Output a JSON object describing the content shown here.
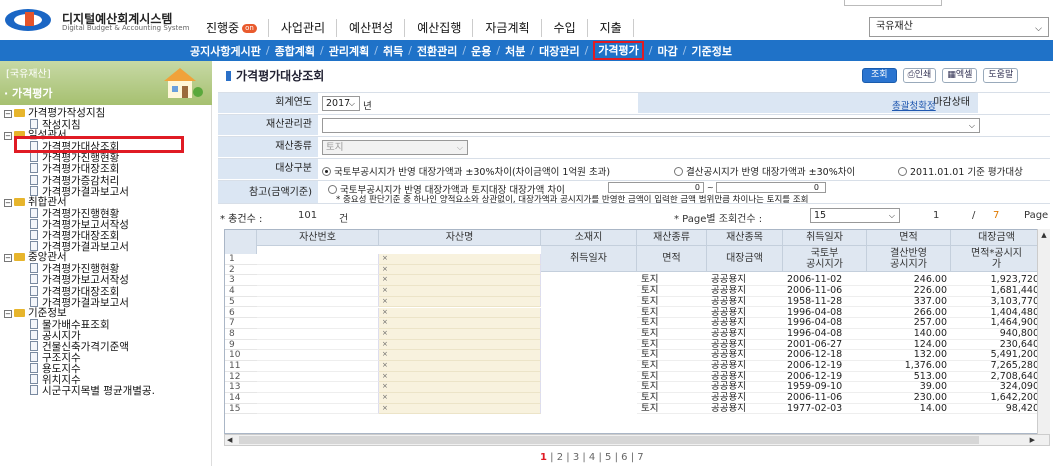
{
  "app": {
    "title": "디지털예산회계시스템",
    "subtitle": "Digital Budget & Accounting System"
  },
  "mainnav": [
    {
      "label": "진행중",
      "badge": "on"
    },
    {
      "label": "사업관리"
    },
    {
      "label": "예산편성"
    },
    {
      "label": "예산집행"
    },
    {
      "label": "자금계획"
    },
    {
      "label": "수입"
    },
    {
      "label": "지출"
    }
  ],
  "org_select": "국유재산",
  "subnav": [
    "공지사항게시판",
    "종합계획",
    "관리계획",
    "취득",
    "전환관리",
    "운용",
    "처분",
    "대장관리",
    "가격평가",
    "마감",
    "기준정보"
  ],
  "subnav_current": "가격평가",
  "sidebar": {
    "org": "[국유재산]",
    "title": "가격평가"
  },
  "tree": [
    {
      "level": 0,
      "type": "folder",
      "label": "가격평가작성지침"
    },
    {
      "level": 1,
      "type": "page",
      "label": "작성지침"
    },
    {
      "level": 0,
      "type": "folder",
      "label": "일성관서"
    },
    {
      "level": 1,
      "type": "page",
      "label": "가격평가대상조회"
    },
    {
      "level": 1,
      "type": "page",
      "label": "가격평가진행현황"
    },
    {
      "level": 1,
      "type": "page",
      "label": "가격평가대장조회"
    },
    {
      "level": 1,
      "type": "page",
      "label": "가격평가증감처리"
    },
    {
      "level": 1,
      "type": "page",
      "label": "가격평가결과보고서"
    },
    {
      "level": 0,
      "type": "folder",
      "label": "취합관서"
    },
    {
      "level": 1,
      "type": "page",
      "label": "가격평가진행현황"
    },
    {
      "level": 1,
      "type": "page",
      "label": "가격평가보고서작성"
    },
    {
      "level": 1,
      "type": "page",
      "label": "가격평가대장조회"
    },
    {
      "level": 1,
      "type": "page",
      "label": "가격평가결과보고서"
    },
    {
      "level": 0,
      "type": "folder",
      "label": "중앙관서"
    },
    {
      "level": 1,
      "type": "page",
      "label": "가격평가진행현황"
    },
    {
      "level": 1,
      "type": "page",
      "label": "가격평가보고서작성"
    },
    {
      "level": 1,
      "type": "page",
      "label": "가격평가대장조회"
    },
    {
      "level": 1,
      "type": "page",
      "label": "가격평가결과보고서"
    },
    {
      "level": 0,
      "type": "folder",
      "label": "기준정보"
    },
    {
      "level": 1,
      "type": "page",
      "label": "물가배수표조회"
    },
    {
      "level": 1,
      "type": "page",
      "label": "공시지가"
    },
    {
      "level": 1,
      "type": "page",
      "label": "건물신축가격기준액"
    },
    {
      "level": 1,
      "type": "page",
      "label": "구조지수"
    },
    {
      "level": 1,
      "type": "page",
      "label": "용도지수"
    },
    {
      "level": 1,
      "type": "page",
      "label": "위치지수"
    },
    {
      "level": 1,
      "type": "page",
      "label": "시군구지목별 평균개별공."
    }
  ],
  "page_title": "가격평가대상조회",
  "buttons": {
    "search": "조회",
    "print": "인쇄",
    "excel": "엑셀",
    "help": "도움말"
  },
  "form": {
    "fiscal_year_label": "회계연도",
    "fiscal_year": "2017",
    "fiscal_year_unit": "년",
    "close_status_label": "마감상태",
    "close_status_link": "총괄청확정",
    "manager_label": "재산관리관",
    "asset_type_label": "재산종류",
    "asset_type": "토지",
    "target_label": "대상구분",
    "target_options": [
      "국토부공시지가 반영 대장가액과 ±30%차이(차이금액이 1억원 초과)",
      "결산공시지가 반영 대장가액과 ±30%차이",
      "2011.01.01 기준 평가대상"
    ],
    "ref_label": "참고(금액기준)",
    "ref_option": "국토부공시지가 반영 대장가액과 토지대장 대장가액 차이",
    "ref_from": "0",
    "ref_tilde": "~",
    "ref_to": "0",
    "ref_note": "* 중요성 판단기준 중 하나인 양적요소와 상관없이, 대장가액과 공시지가를 반영한 금액이 입력한 금액 범위만큼 차이나는 토지를 조회"
  },
  "count": {
    "total_label": "* 총건수 :",
    "total": "101",
    "total_unit": "건",
    "per_page_label": "* Page별 조회건수 :",
    "per_page": "15",
    "page": "1",
    "slash": "/",
    "pages": "7",
    "page_word": "Page"
  },
  "grid": {
    "headers": [
      "자산번호",
      "자산명",
      "소재지",
      "재산종류",
      "재산종목",
      "취득일자",
      "면적",
      "대장금액"
    ],
    "subheaders": [
      "취득일자",
      "면적",
      "대장금액",
      "국토부\n공시지가",
      "결산반영\n공시지가",
      "면적*공시지\n가"
    ],
    "rows": [
      {
        "n": "1",
        "kind": "",
        "item": "",
        "date": "",
        "area": "",
        "amount": ""
      },
      {
        "n": "2",
        "kind": "",
        "item": "",
        "date": "",
        "area": "",
        "amount": ""
      },
      {
        "n": "3",
        "kind": "토지",
        "item": "공공용지",
        "date": "2006-11-02",
        "area": "246.00",
        "amount": "1,923,720"
      },
      {
        "n": "4",
        "kind": "토지",
        "item": "공공용지",
        "date": "2006-11-06",
        "area": "226.00",
        "amount": "1,681,440"
      },
      {
        "n": "5",
        "kind": "토지",
        "item": "공공용지",
        "date": "1958-11-28",
        "area": "337.00",
        "amount": "3,103,770"
      },
      {
        "n": "6",
        "kind": "토지",
        "item": "공공용지",
        "date": "1996-04-08",
        "area": "266.00",
        "amount": "1,404,480"
      },
      {
        "n": "7",
        "kind": "토지",
        "item": "공공용지",
        "date": "1996-04-08",
        "area": "257.00",
        "amount": "1,464,900"
      },
      {
        "n": "8",
        "kind": "토지",
        "item": "공공용지",
        "date": "1996-04-08",
        "area": "140.00",
        "amount": "940,800"
      },
      {
        "n": "9",
        "kind": "토지",
        "item": "공공용지",
        "date": "2001-06-27",
        "area": "124.00",
        "amount": "230,640"
      },
      {
        "n": "10",
        "kind": "토지",
        "item": "공공용지",
        "date": "2006-12-18",
        "area": "132.00",
        "amount": "5,491,200"
      },
      {
        "n": "11",
        "kind": "토지",
        "item": "공공용지",
        "date": "2006-12-19",
        "area": "1,376.00",
        "amount": "7,265,280"
      },
      {
        "n": "12",
        "kind": "토지",
        "item": "공공용지",
        "date": "2006-12-19",
        "area": "513.00",
        "amount": "2,708,640"
      },
      {
        "n": "13",
        "kind": "토지",
        "item": "공공용지",
        "date": "1959-09-10",
        "area": "39.00",
        "amount": "324,090"
      },
      {
        "n": "14",
        "kind": "토지",
        "item": "공공용지",
        "date": "2006-11-06",
        "area": "230.00",
        "amount": "1,642,200"
      },
      {
        "n": "15",
        "kind": "토지",
        "item": "공공용지",
        "date": "1977-02-03",
        "area": "14.00",
        "amount": "98,420"
      }
    ]
  },
  "pager": [
    "1",
    "2",
    "3",
    "4",
    "5",
    "6",
    "7"
  ],
  "colors": {
    "accent": "#1f72c8",
    "highlight": "#e01b24"
  }
}
